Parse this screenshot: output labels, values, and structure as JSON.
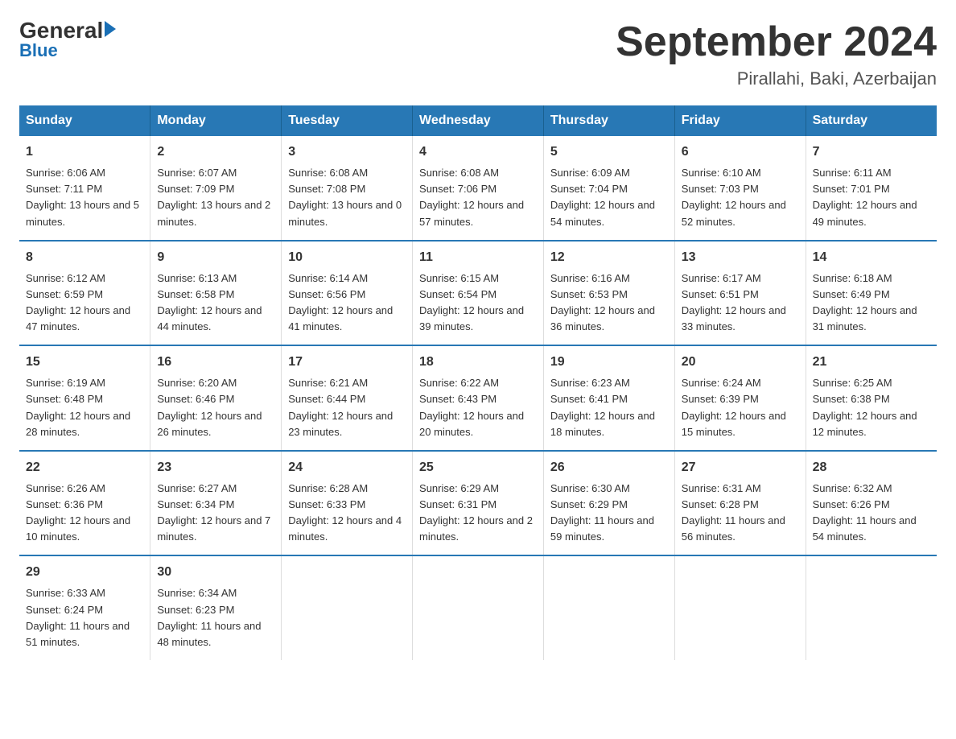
{
  "logo": {
    "general": "General",
    "blue": "Blue"
  },
  "title": {
    "main": "September 2024",
    "subtitle": "Pirallahi, Baki, Azerbaijan"
  },
  "days_of_week": [
    "Sunday",
    "Monday",
    "Tuesday",
    "Wednesday",
    "Thursday",
    "Friday",
    "Saturday"
  ],
  "weeks": [
    [
      {
        "day": "1",
        "sunrise": "Sunrise: 6:06 AM",
        "sunset": "Sunset: 7:11 PM",
        "daylight": "Daylight: 13 hours and 5 minutes."
      },
      {
        "day": "2",
        "sunrise": "Sunrise: 6:07 AM",
        "sunset": "Sunset: 7:09 PM",
        "daylight": "Daylight: 13 hours and 2 minutes."
      },
      {
        "day": "3",
        "sunrise": "Sunrise: 6:08 AM",
        "sunset": "Sunset: 7:08 PM",
        "daylight": "Daylight: 13 hours and 0 minutes."
      },
      {
        "day": "4",
        "sunrise": "Sunrise: 6:08 AM",
        "sunset": "Sunset: 7:06 PM",
        "daylight": "Daylight: 12 hours and 57 minutes."
      },
      {
        "day": "5",
        "sunrise": "Sunrise: 6:09 AM",
        "sunset": "Sunset: 7:04 PM",
        "daylight": "Daylight: 12 hours and 54 minutes."
      },
      {
        "day": "6",
        "sunrise": "Sunrise: 6:10 AM",
        "sunset": "Sunset: 7:03 PM",
        "daylight": "Daylight: 12 hours and 52 minutes."
      },
      {
        "day": "7",
        "sunrise": "Sunrise: 6:11 AM",
        "sunset": "Sunset: 7:01 PM",
        "daylight": "Daylight: 12 hours and 49 minutes."
      }
    ],
    [
      {
        "day": "8",
        "sunrise": "Sunrise: 6:12 AM",
        "sunset": "Sunset: 6:59 PM",
        "daylight": "Daylight: 12 hours and 47 minutes."
      },
      {
        "day": "9",
        "sunrise": "Sunrise: 6:13 AM",
        "sunset": "Sunset: 6:58 PM",
        "daylight": "Daylight: 12 hours and 44 minutes."
      },
      {
        "day": "10",
        "sunrise": "Sunrise: 6:14 AM",
        "sunset": "Sunset: 6:56 PM",
        "daylight": "Daylight: 12 hours and 41 minutes."
      },
      {
        "day": "11",
        "sunrise": "Sunrise: 6:15 AM",
        "sunset": "Sunset: 6:54 PM",
        "daylight": "Daylight: 12 hours and 39 minutes."
      },
      {
        "day": "12",
        "sunrise": "Sunrise: 6:16 AM",
        "sunset": "Sunset: 6:53 PM",
        "daylight": "Daylight: 12 hours and 36 minutes."
      },
      {
        "day": "13",
        "sunrise": "Sunrise: 6:17 AM",
        "sunset": "Sunset: 6:51 PM",
        "daylight": "Daylight: 12 hours and 33 minutes."
      },
      {
        "day": "14",
        "sunrise": "Sunrise: 6:18 AM",
        "sunset": "Sunset: 6:49 PM",
        "daylight": "Daylight: 12 hours and 31 minutes."
      }
    ],
    [
      {
        "day": "15",
        "sunrise": "Sunrise: 6:19 AM",
        "sunset": "Sunset: 6:48 PM",
        "daylight": "Daylight: 12 hours and 28 minutes."
      },
      {
        "day": "16",
        "sunrise": "Sunrise: 6:20 AM",
        "sunset": "Sunset: 6:46 PM",
        "daylight": "Daylight: 12 hours and 26 minutes."
      },
      {
        "day": "17",
        "sunrise": "Sunrise: 6:21 AM",
        "sunset": "Sunset: 6:44 PM",
        "daylight": "Daylight: 12 hours and 23 minutes."
      },
      {
        "day": "18",
        "sunrise": "Sunrise: 6:22 AM",
        "sunset": "Sunset: 6:43 PM",
        "daylight": "Daylight: 12 hours and 20 minutes."
      },
      {
        "day": "19",
        "sunrise": "Sunrise: 6:23 AM",
        "sunset": "Sunset: 6:41 PM",
        "daylight": "Daylight: 12 hours and 18 minutes."
      },
      {
        "day": "20",
        "sunrise": "Sunrise: 6:24 AM",
        "sunset": "Sunset: 6:39 PM",
        "daylight": "Daylight: 12 hours and 15 minutes."
      },
      {
        "day": "21",
        "sunrise": "Sunrise: 6:25 AM",
        "sunset": "Sunset: 6:38 PM",
        "daylight": "Daylight: 12 hours and 12 minutes."
      }
    ],
    [
      {
        "day": "22",
        "sunrise": "Sunrise: 6:26 AM",
        "sunset": "Sunset: 6:36 PM",
        "daylight": "Daylight: 12 hours and 10 minutes."
      },
      {
        "day": "23",
        "sunrise": "Sunrise: 6:27 AM",
        "sunset": "Sunset: 6:34 PM",
        "daylight": "Daylight: 12 hours and 7 minutes."
      },
      {
        "day": "24",
        "sunrise": "Sunrise: 6:28 AM",
        "sunset": "Sunset: 6:33 PM",
        "daylight": "Daylight: 12 hours and 4 minutes."
      },
      {
        "day": "25",
        "sunrise": "Sunrise: 6:29 AM",
        "sunset": "Sunset: 6:31 PM",
        "daylight": "Daylight: 12 hours and 2 minutes."
      },
      {
        "day": "26",
        "sunrise": "Sunrise: 6:30 AM",
        "sunset": "Sunset: 6:29 PM",
        "daylight": "Daylight: 11 hours and 59 minutes."
      },
      {
        "day": "27",
        "sunrise": "Sunrise: 6:31 AM",
        "sunset": "Sunset: 6:28 PM",
        "daylight": "Daylight: 11 hours and 56 minutes."
      },
      {
        "day": "28",
        "sunrise": "Sunrise: 6:32 AM",
        "sunset": "Sunset: 6:26 PM",
        "daylight": "Daylight: 11 hours and 54 minutes."
      }
    ],
    [
      {
        "day": "29",
        "sunrise": "Sunrise: 6:33 AM",
        "sunset": "Sunset: 6:24 PM",
        "daylight": "Daylight: 11 hours and 51 minutes."
      },
      {
        "day": "30",
        "sunrise": "Sunrise: 6:34 AM",
        "sunset": "Sunset: 6:23 PM",
        "daylight": "Daylight: 11 hours and 48 minutes."
      },
      null,
      null,
      null,
      null,
      null
    ]
  ]
}
